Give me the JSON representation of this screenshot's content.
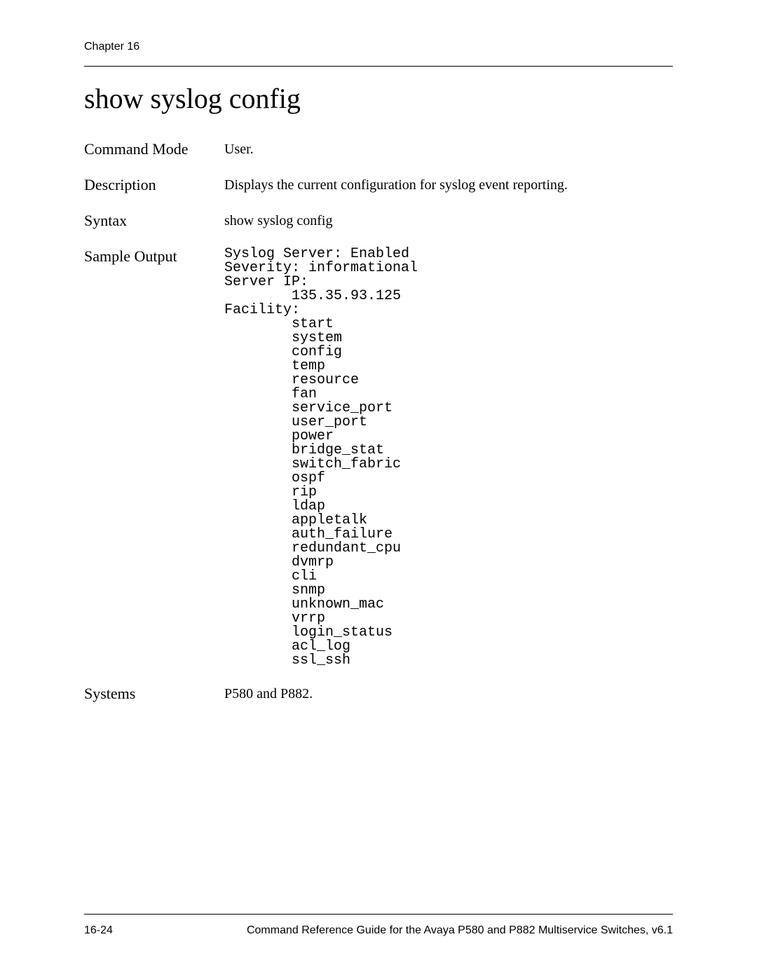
{
  "header": {
    "chapter": "Chapter 16"
  },
  "title": "show syslog config",
  "rows": {
    "command_mode": {
      "label": "Command Mode",
      "value": "User."
    },
    "description": {
      "label": "Description",
      "value": "Displays the current configuration for syslog event reporting."
    },
    "syntax": {
      "label": "Syntax",
      "value": "show syslog config"
    },
    "sample": {
      "label": "Sample Output"
    },
    "systems": {
      "label": "Systems",
      "value": "P580 and P882."
    }
  },
  "sample_output": {
    "syslog_server": "Syslog Server: Enabled",
    "severity": "Severity: informational",
    "server_ip_label": "Server IP:",
    "server_ip_value": "135.35.93.125",
    "facility_label": "Facility:",
    "facilities": [
      "start",
      "system",
      "config",
      "temp",
      "resource",
      "fan",
      "service_port",
      "user_port",
      "power",
      "bridge_stat",
      "switch_fabric",
      "ospf",
      "rip",
      "ldap",
      "appletalk",
      "auth_failure",
      "redundant_cpu",
      "dvmrp",
      "cli",
      "snmp",
      "unknown_mac",
      "vrrp",
      "login_status",
      "acl_log",
      "ssl_ssh"
    ]
  },
  "footer": {
    "page": "16-24",
    "doc": "Command Reference Guide for the Avaya P580 and P882 Multiservice Switches, v6.1"
  }
}
